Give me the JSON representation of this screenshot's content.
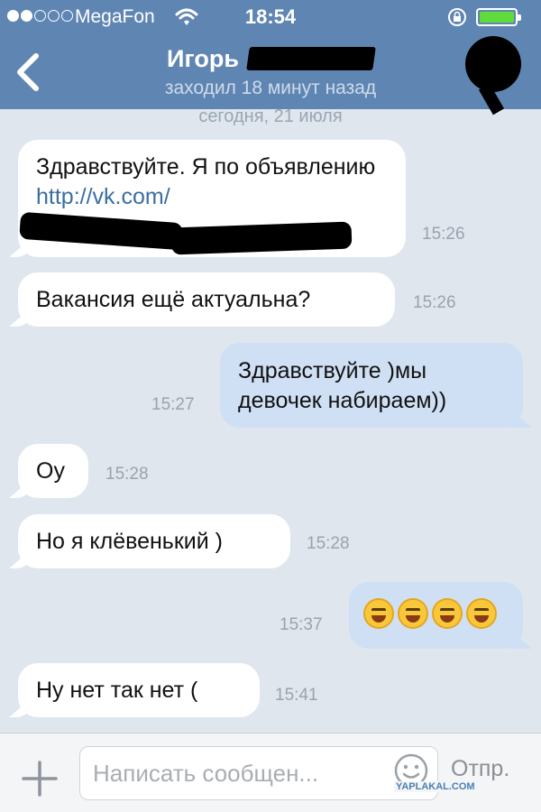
{
  "status": {
    "carrier": "MegaFon",
    "time": "18:54",
    "battery_color": "#5fdc3c"
  },
  "header": {
    "contact_name": "Игорь",
    "last_seen": "заходил 18 минут назад",
    "accent": "#5f86b3"
  },
  "chat": {
    "date": "сегодня, 21 июля",
    "messages": [
      {
        "dir": "in",
        "text_a": "Здравствуйте. Я по объявлению ",
        "link": "http://vk.com/",
        "time": "15:26"
      },
      {
        "dir": "in",
        "text": "Вакансия ещё актуальна?",
        "time": "15:26"
      },
      {
        "dir": "out",
        "text": "Здравствуйте )мы девочек набираем))",
        "time": "15:27"
      },
      {
        "dir": "in",
        "text": "Оу",
        "time": "15:28"
      },
      {
        "dir": "in",
        "text": "Но я клёвенький )",
        "time": "15:28"
      },
      {
        "dir": "out",
        "emoji": [
          "laughing",
          "laughing",
          "laughing",
          "winking"
        ],
        "time": "15:37"
      },
      {
        "dir": "in",
        "text": "Ну нет так нет (",
        "time": "15:41"
      }
    ]
  },
  "composer": {
    "placeholder": "Написать сообщен...",
    "send_label": "Отпр."
  },
  "watermark": "YAPLAKAL.COM"
}
